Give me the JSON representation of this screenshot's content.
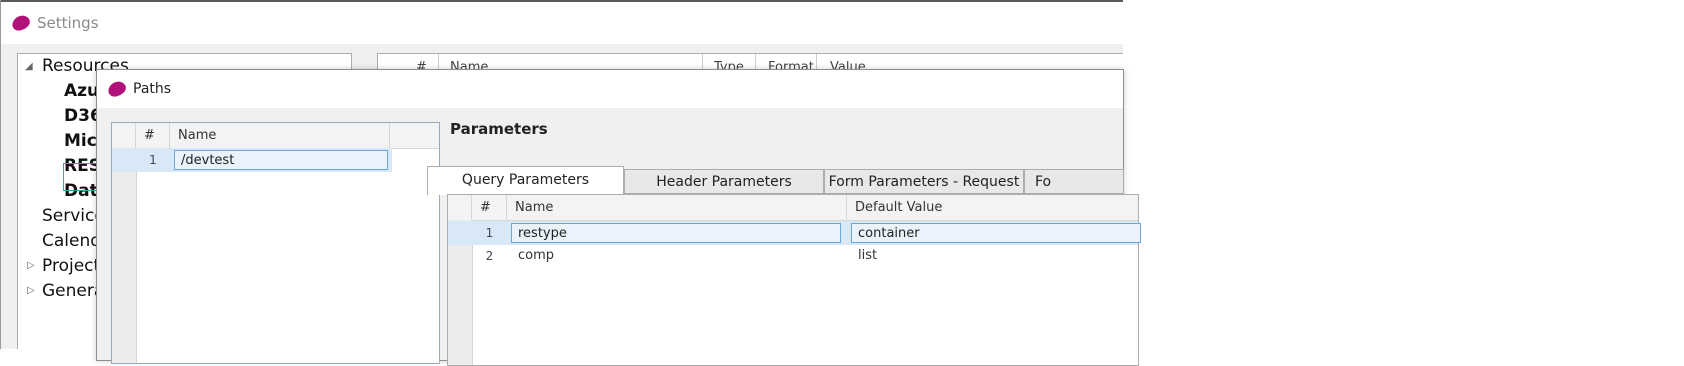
{
  "settings": {
    "title": "Settings",
    "tree": {
      "resources": "Resources",
      "children": [
        "Azu",
        "D36",
        "Mic",
        "RES",
        "Dat"
      ],
      "services": "Service",
      "calendars": "Calend",
      "projects": "Project",
      "general": "Genera"
    },
    "grid_headers": [
      "#",
      "Name",
      "Type",
      "Format",
      "Value"
    ]
  },
  "paths_dialog": {
    "title": "Paths",
    "grid": {
      "headers": {
        "num": "#",
        "name": "Name"
      },
      "rows": [
        {
          "num": "1",
          "name": "/devtest"
        }
      ]
    },
    "parameters_heading": "Parameters",
    "tabs": [
      "Query Parameters",
      "Header Parameters",
      "Form Parameters - Request",
      "Fo"
    ],
    "active_tab": "Query Parameters",
    "param_grid": {
      "headers": {
        "num": "#",
        "name": "Name",
        "default": "Default Value"
      },
      "rows": [
        {
          "num": "1",
          "name": "restype",
          "default": "container"
        },
        {
          "num": "2",
          "name": "comp",
          "default": "list"
        }
      ]
    }
  },
  "colors": {
    "logo": "#b0127a",
    "selection": "#d9e8f6",
    "focus_border": "#3aa3a3"
  }
}
